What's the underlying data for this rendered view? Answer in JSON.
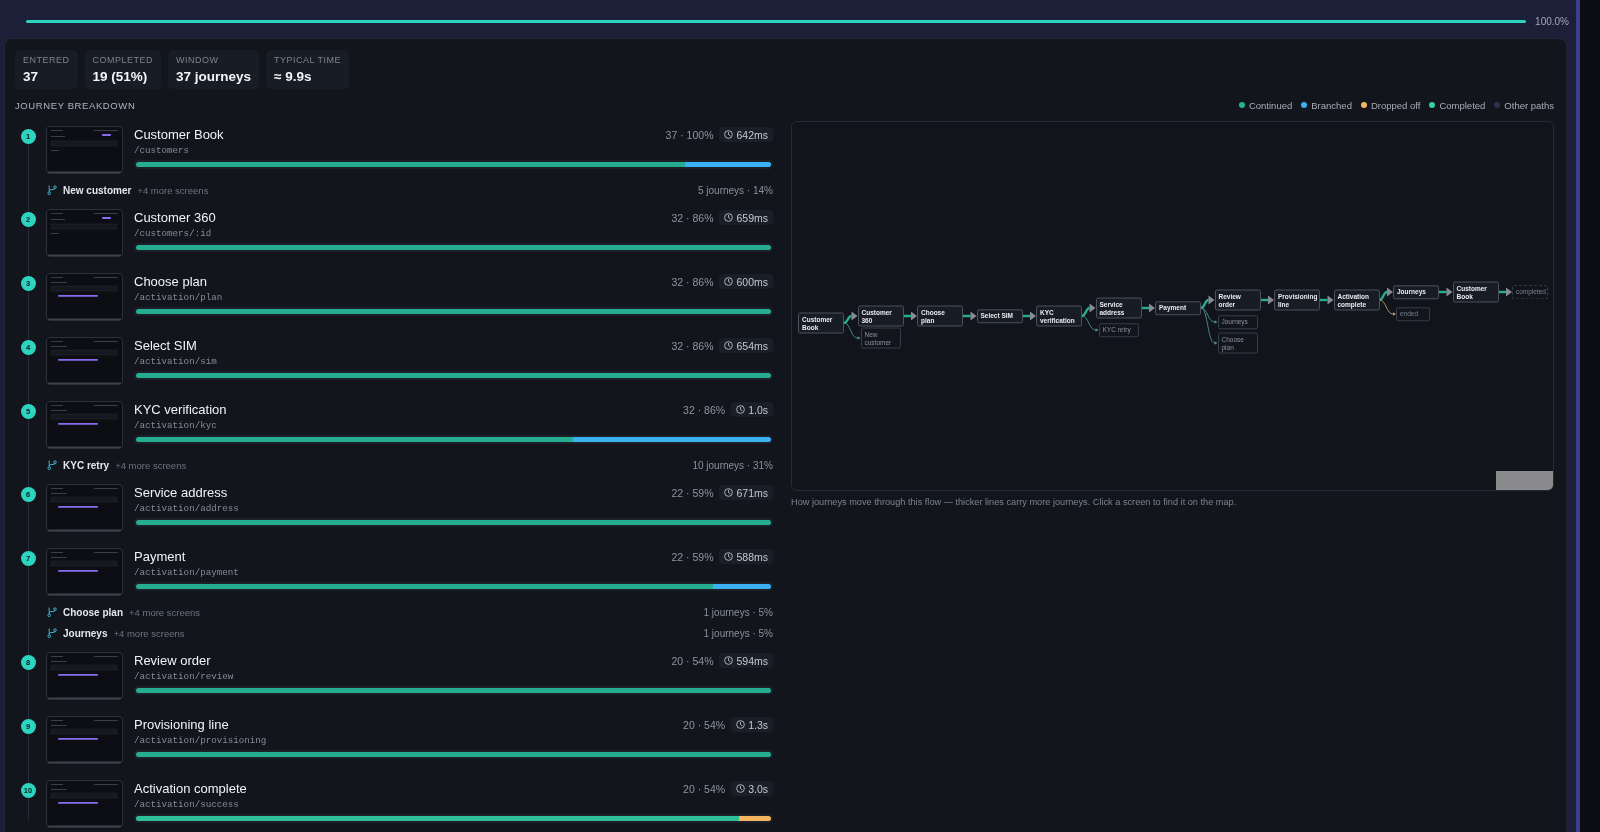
{
  "header": {
    "progress": {
      "level": 1,
      "reading": "100.0%"
    }
  },
  "stats": [
    {
      "label": "ENTERED",
      "value": "37"
    },
    {
      "label": "COMPLETED",
      "value": "19 (51%)"
    },
    {
      "label": "WINDOW",
      "value": "37 journeys"
    },
    {
      "label": "TYPICAL TIME",
      "value": "≈ 9.9s"
    }
  ],
  "breakdown": {
    "title": "JOURNEY BREAKDOWN",
    "steps": [
      {
        "number": "1",
        "title": "Customer Book",
        "path": "/customers",
        "count": "37 · 100%",
        "time": "642ms",
        "thumbnail": {
          "kind": "list"
        },
        "segments": [
          {
            "kind": "continued",
            "level": 0.865
          },
          {
            "kind": "branched",
            "level": 0.135
          }
        ],
        "branches": [
          {
            "label": "New customer",
            "more": "+4 more screens",
            "share": "5 journeys · 14%"
          }
        ]
      },
      {
        "number": "2",
        "title": "Customer 360",
        "path": "/customers/:id",
        "count": "32 · 86%",
        "time": "659ms",
        "thumbnail": {
          "kind": "list"
        },
        "segments": [
          {
            "kind": "continued",
            "level": 1
          }
        ]
      },
      {
        "number": "3",
        "title": "Choose plan",
        "path": "/activation/plan",
        "count": "32 · 86%",
        "time": "600ms",
        "thumbnail": {
          "kind": "form"
        },
        "segments": [
          {
            "kind": "continued",
            "level": 1
          }
        ]
      },
      {
        "number": "4",
        "title": "Select SIM",
        "path": "/activation/sim",
        "count": "32 · 86%",
        "time": "654ms",
        "thumbnail": {
          "kind": "form"
        },
        "segments": [
          {
            "kind": "continued",
            "level": 1
          }
        ]
      },
      {
        "number": "5",
        "title": "KYC verification",
        "path": "/activation/kyc",
        "count": "32 · 86%",
        "time": "1.0s",
        "thumbnail": {
          "kind": "form"
        },
        "segments": [
          {
            "kind": "continued",
            "level": 0.688
          },
          {
            "kind": "branched",
            "level": 0.312
          }
        ],
        "branches": [
          {
            "label": "KYC retry",
            "more": "+4 more screens",
            "share": "10 journeys · 31%"
          }
        ]
      },
      {
        "number": "6",
        "title": "Service address",
        "path": "/activation/address",
        "count": "22 · 59%",
        "time": "671ms",
        "thumbnail": {
          "kind": "form"
        },
        "segments": [
          {
            "kind": "continued",
            "level": 1
          }
        ]
      },
      {
        "number": "7",
        "title": "Payment",
        "path": "/activation/payment",
        "count": "22 · 59%",
        "time": "588ms",
        "thumbnail": {
          "kind": "form"
        },
        "segments": [
          {
            "kind": "continued",
            "level": 0.909
          },
          {
            "kind": "branched",
            "level": 0.091
          }
        ],
        "branches": [
          {
            "label": "Choose plan",
            "more": "+4 more screens",
            "share": "1 journeys · 5%"
          },
          {
            "label": "Journeys",
            "more": "+4 more screens",
            "share": "1 journeys · 5%"
          }
        ]
      },
      {
        "number": "8",
        "title": "Review order",
        "path": "/activation/review",
        "count": "20 · 54%",
        "time": "594ms",
        "thumbnail": {
          "kind": "form"
        },
        "segments": [
          {
            "kind": "continued",
            "level": 1
          }
        ]
      },
      {
        "number": "9",
        "title": "Provisioning line",
        "path": "/activation/provisioning",
        "count": "20 · 54%",
        "time": "1.3s",
        "thumbnail": {
          "kind": "form"
        },
        "segments": [
          {
            "kind": "continued",
            "level": 1
          }
        ]
      },
      {
        "number": "10",
        "title": "Activation complete",
        "path": "/activation/success",
        "count": "20 · 54%",
        "time": "3.0s",
        "thumbnail": {
          "kind": "form"
        },
        "segments": [
          {
            "kind": "completed",
            "level": 0.95
          },
          {
            "kind": "dropped",
            "level": 0.05
          }
        ]
      }
    ]
  },
  "flow_map": {
    "legend": [
      {
        "label": "Continued",
        "color": "#22b395"
      },
      {
        "label": "Branched",
        "color": "#3bb1f3"
      },
      {
        "label": "Dropped off",
        "color": "#f4b55e"
      },
      {
        "label": "Completed",
        "color": "#35d0a0"
      },
      {
        "label": "Other paths",
        "color": "#2c3250"
      }
    ],
    "nodes": [
      {
        "label": "Customer Book",
        "kind": "screen",
        "branches": [
          {
            "label": "New customer",
            "kind": "branched"
          }
        ]
      },
      {
        "label": "Customer 360",
        "kind": "screen"
      },
      {
        "label": "Choose plan",
        "kind": "screen"
      },
      {
        "label": "Select SIM",
        "kind": "screen"
      },
      {
        "label": "KYC verification",
        "kind": "screen",
        "branches": [
          {
            "label": "KYC retry",
            "kind": "branched"
          }
        ]
      },
      {
        "label": "Service address",
        "kind": "screen"
      },
      {
        "label": "Payment",
        "kind": "screen",
        "branches": [
          {
            "label": "Journeys",
            "kind": "branched"
          },
          {
            "label": "Choose plan",
            "kind": "branched"
          }
        ]
      },
      {
        "label": "Review order",
        "kind": "screen"
      },
      {
        "label": "Provisioning line",
        "kind": "screen"
      },
      {
        "label": "Activation complete",
        "kind": "screen",
        "branches": [
          {
            "label": "ended",
            "kind": "dropped"
          }
        ]
      },
      {
        "label": "Journeys",
        "kind": "screen"
      },
      {
        "label": "Customer Book",
        "kind": "screen"
      },
      {
        "label": "completed",
        "kind": "end"
      }
    ],
    "caption": "How journeys move through this flow — thicker lines carry more journeys. Click a screen to find it on the map."
  }
}
